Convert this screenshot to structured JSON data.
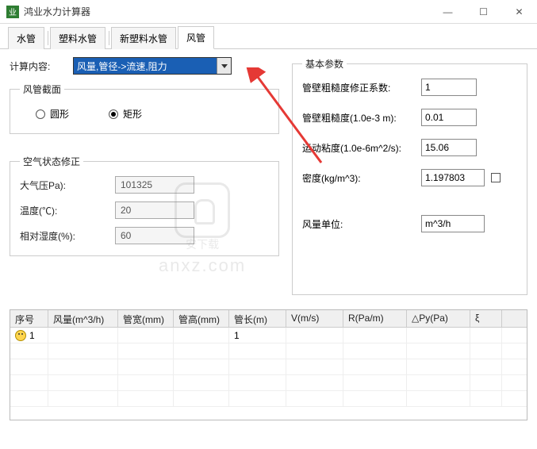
{
  "window": {
    "title": "鸿业水力计算器",
    "buttons": {
      "min": "—",
      "max": "☐",
      "close": "✕"
    }
  },
  "tabs": [
    "水管",
    "塑料水管",
    "新塑料水管",
    "风管"
  ],
  "active_tab": 3,
  "calc": {
    "label": "计算内容:",
    "selected": "风量,管径->流速,阻力"
  },
  "section_crosssection": {
    "legend": "风管截面",
    "opt_circle": "圆形",
    "opt_rect": "矩形",
    "selected": "rect"
  },
  "section_air": {
    "legend": "空气状态修正",
    "pressure_label": "大气压Pa):",
    "pressure_value": "101325",
    "temp_label": "温度(℃):",
    "temp_value": "20",
    "humidity_label": "相对湿度(%):",
    "humidity_value": "60"
  },
  "basic_params": {
    "legend": "基本参数",
    "rough_coef_label": "管壁粗糙度修正系数:",
    "rough_coef_value": "1",
    "roughness_label": "管壁粗糙度(1.0e-3 m):",
    "roughness_value": "0.01",
    "viscosity_label": "运动粘度(1.0e-6m^2/s):",
    "viscosity_value": "15.06",
    "density_label": "密度(kg/m^3):",
    "density_value": "1.197803",
    "unit_label": "风量单位:",
    "unit_value": "m^3/h"
  },
  "table": {
    "headers": [
      "序号",
      "风量(m^3/h)",
      "管宽(mm)",
      "管高(mm)",
      "管长(m)",
      "V(m/s)",
      "R(Pa/m)",
      "△Py(Pa)",
      "ξ"
    ],
    "rows": [
      {
        "seq": "1",
        "length": "1"
      }
    ]
  },
  "watermark": {
    "domain": "anxz.com",
    "cn": "安下载"
  }
}
